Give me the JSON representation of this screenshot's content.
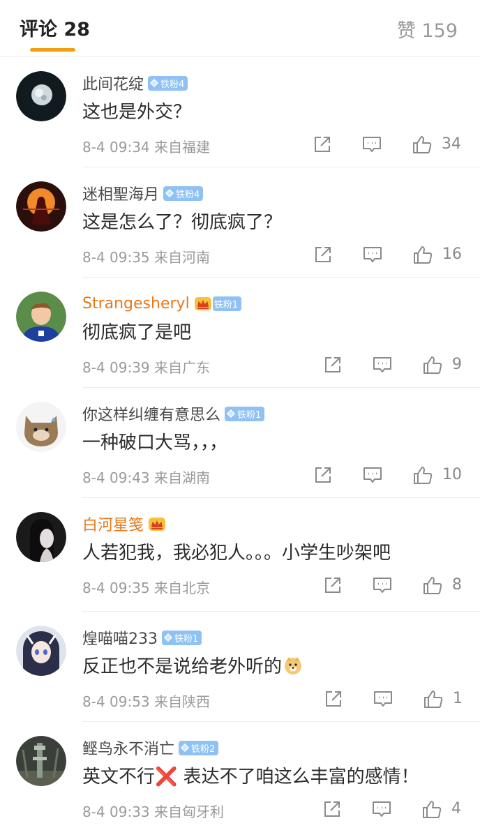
{
  "header": {
    "comments_tab": "评论 28",
    "likes_tab": "赞 159"
  },
  "colors": {
    "accent": "#f2a00f",
    "vip_name": "#e9781a",
    "badge": "#8fc1f5"
  },
  "comments": [
    {
      "user": "此间花绽",
      "badge": "铁粉4",
      "text": "这也是外交？",
      "meta": "8-4 09:34  来自福建",
      "likes": "34"
    },
    {
      "user": "迷相聖海月",
      "badge": "铁粉4",
      "text": "这是怎么了？彻底疯了？",
      "meta": "8-4 09:35  来自河南",
      "likes": "16"
    },
    {
      "user": "Strangesheryl",
      "badge": "铁粉1",
      "text": "彻底疯了是吧",
      "meta": "8-4 09:39  来自广东",
      "likes": "9"
    },
    {
      "user": "你这样纠缠有意思么",
      "badge": "铁粉1",
      "text": "一种破口大骂，，，",
      "meta": "8-4 09:43  来自湖南",
      "likes": "10"
    },
    {
      "user": "白河星笺",
      "badge": "",
      "text": "人若犯我，我必犯人。。。小学生吵架吧",
      "meta": "8-4 09:35  来自北京",
      "likes": "8"
    },
    {
      "user": "煌喵喵233",
      "badge": "铁粉1",
      "text": "反正也不是说给老外听的",
      "meta": "8-4 09:53  来自陕西",
      "likes": "1"
    },
    {
      "user": "鲣鸟永不消亡",
      "badge": "铁粉2",
      "text": "英文不行❌ 表达不了咱这么丰富的感情！",
      "meta": "8-4 09:33  来自匈牙利",
      "likes": "4"
    }
  ],
  "icons": {
    "share": "share-icon",
    "comment": "comment-icon",
    "like": "thumbs-up-icon",
    "badge": "diamond-icon",
    "vip": "crown-icon"
  }
}
